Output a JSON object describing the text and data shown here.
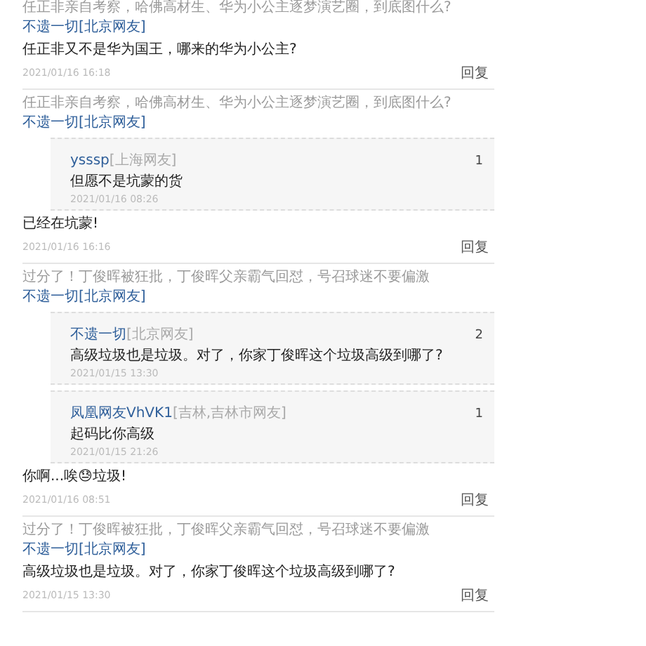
{
  "posts": [
    {
      "title": "任正非亲自考察，哈佛高材生、华为小公主逐梦演艺圈，到底图什么?",
      "author": "不遗一切[北京网友]",
      "comment": "任正非又不是华为国王，哪来的华为小公主?",
      "time": "2021/01/16 16:18",
      "reply_label": "回复"
    },
    {
      "title": "任正非亲自考察，哈佛高材生、华为小公主逐梦演艺圈，到底图什么?",
      "author": "不遗一切[北京网友]",
      "replies": [
        {
          "name": "ysssp",
          "location": "[上海网友]",
          "count": "1",
          "text": "但愿不是坑蒙的货",
          "time": "2021/01/16 08:26"
        }
      ],
      "comment": "已经在坑蒙!",
      "time": "2021/01/16 16:16",
      "reply_label": "回复"
    },
    {
      "title": "过分了！丁俊晖被狂批，丁俊晖父亲霸气回怼，号召球迷不要偏激",
      "author": "不遗一切[北京网友]",
      "replies": [
        {
          "name": "不遗一切",
          "location": "[北京网友]",
          "count": "2",
          "text": "高级垃圾也是垃圾。对了，你家丁俊晖这个垃圾高级到哪了?",
          "time": "2021/01/15 13:30"
        },
        {
          "name": "凤凰网友VhVK1",
          "location": "[吉林,吉林市网友]",
          "count": "1",
          "text": "起码比你高级",
          "time": "2021/01/15 21:26"
        }
      ],
      "comment": "你啊...唉😓垃圾!",
      "time": "2021/01/16 08:51",
      "reply_label": "回复"
    },
    {
      "title": "过分了！丁俊晖被狂批，丁俊晖父亲霸气回怼，号召球迷不要偏激",
      "author": "不遗一切[北京网友]",
      "comment": "高级垃圾也是垃圾。对了，你家丁俊晖这个垃圾高级到哪了?",
      "time": "2021/01/15 13:30",
      "reply_label": "回复"
    }
  ]
}
